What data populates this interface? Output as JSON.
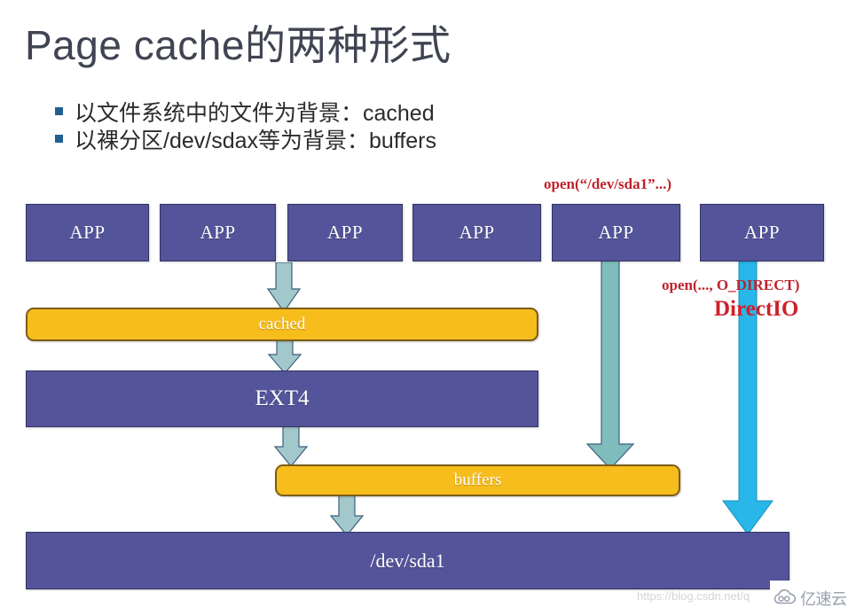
{
  "slide": {
    "title": "Page cache的两种形式",
    "title_color": "#404452",
    "background": "#ffffff"
  },
  "bullets": [
    {
      "marker": "square-bullet-icon",
      "text": "以文件系统中的文件为背景：cached"
    },
    {
      "marker": "square-bullet-icon",
      "text": "以裸分区/dev/sdax等为背景：buffers"
    }
  ],
  "palette": {
    "box_blue": "#54549b",
    "box_blue_border": "#33335f",
    "bar_orange": "#f6bd1c",
    "bar_orange_border": "#7d5c18",
    "arrow_teal": "#9fc5c7",
    "arrow_teal_border": "#3e5f7e",
    "arrow_seafoam": "#7dbdbc",
    "arrow_cyan": "#29b6e8",
    "annotation_red": "#c0232c",
    "directio_red": "#d0202a",
    "bullet_blue": "#1f6091"
  },
  "diagram": {
    "app_boxes": [
      {
        "label": "APP"
      },
      {
        "label": "APP"
      },
      {
        "label": "APP"
      },
      {
        "label": "APP"
      },
      {
        "label": "APP"
      },
      {
        "label": "APP"
      }
    ],
    "layers": {
      "cached": "cached",
      "ext4": "EXT4",
      "buffers": "buffers",
      "device": "/dev/sda1"
    },
    "annotations": [
      {
        "name": "open-dev-sda1",
        "text": "open(“/dev/sda1”...)"
      },
      {
        "name": "open-o-direct",
        "text": "open(..., O_DIRECT)"
      },
      {
        "name": "directio",
        "text": "DirectIO"
      }
    ],
    "arrows": [
      {
        "name": "arrow-app3-to-cached",
        "color": "#9fc5c7"
      },
      {
        "name": "arrow-cached-to-ext4",
        "color": "#9fc5c7"
      },
      {
        "name": "arrow-ext4-to-buffers",
        "color": "#9fc5c7"
      },
      {
        "name": "arrow-app5-to-buffers",
        "color": "#7dbdbc"
      },
      {
        "name": "arrow-buffers-to-device",
        "color": "#9fc5c7"
      },
      {
        "name": "arrow-app6-to-device",
        "color": "#29b6e8"
      }
    ]
  },
  "watermark": {
    "url": "https://blog.csdn.net/q",
    "logo_icon": "cloud-icon",
    "logo_text": "亿速云"
  }
}
